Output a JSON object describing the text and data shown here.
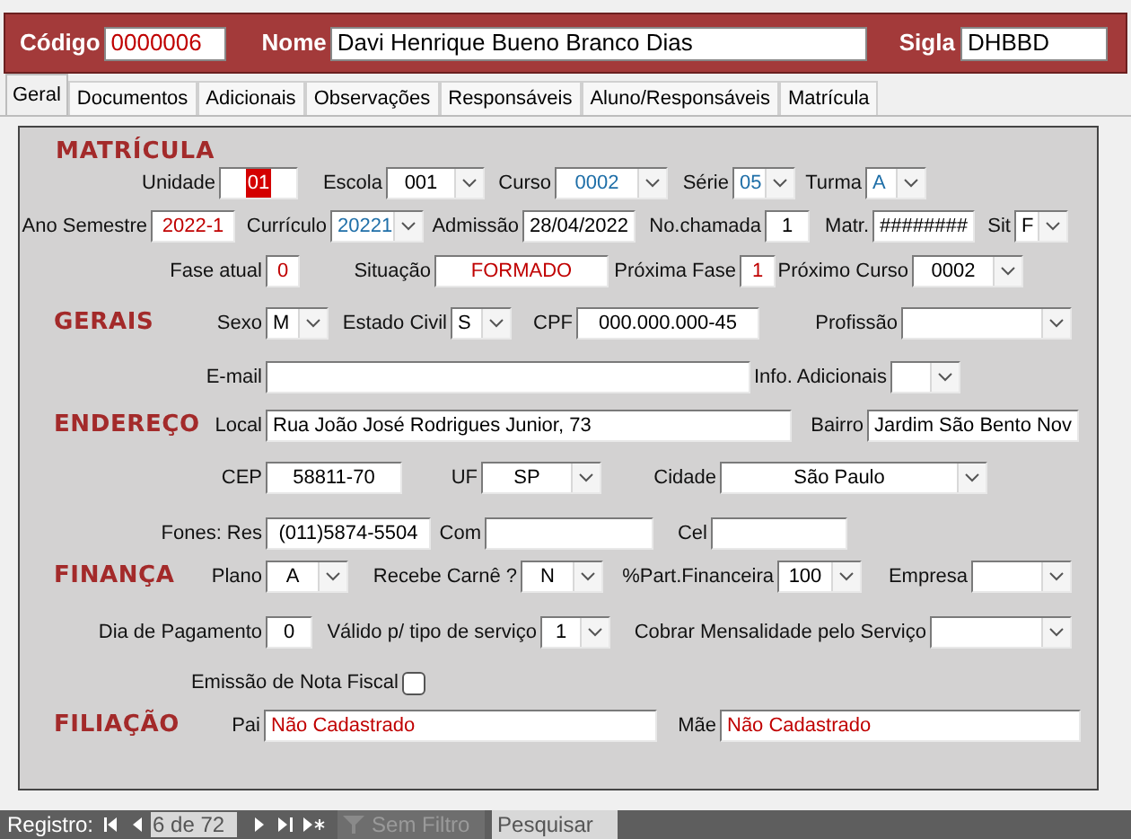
{
  "header": {
    "fields": [
      {
        "label": "Código",
        "value": "0000006",
        "color": "#c00000"
      },
      {
        "label": "Nome",
        "value": "Davi Henrique Bueno Branco Dias",
        "color": "#000000"
      },
      {
        "label": "Sigla",
        "value": "DHBBD",
        "color": "#000000"
      }
    ]
  },
  "tabs": [
    {
      "label": "Geral",
      "selected": true
    },
    {
      "label": "Documentos",
      "selected": false
    },
    {
      "label": "Adicionais",
      "selected": false
    },
    {
      "label": "Observações",
      "selected": false
    },
    {
      "label": "Responsáveis",
      "selected": false
    },
    {
      "label": "Aluno/Responsáveis",
      "selected": false
    },
    {
      "label": "Matrícula",
      "selected": false
    }
  ],
  "sections": [
    {
      "title": "MATRÍCULA",
      "title_inline": false,
      "rows": [
        {
          "fields": [
            {
              "kind": "highlight",
              "label": "Unidade",
              "value": "01",
              "color": "#d40000"
            },
            {
              "kind": "combo",
              "label": "Escola",
              "value": "001",
              "color": "#000000"
            },
            {
              "kind": "combo",
              "label": "Curso",
              "value": "0002",
              "color": "#1f6fa8"
            },
            {
              "kind": "combo",
              "label": "Série",
              "value": "05",
              "color": "#1f6fa8"
            },
            {
              "kind": "combo",
              "label": "Turma",
              "value": "A",
              "color": "#1f6fa8"
            }
          ]
        },
        {
          "fields": [
            {
              "kind": "text",
              "label": "Ano Semestre",
              "value": "2022-1",
              "color": "#c00000"
            },
            {
              "kind": "combo",
              "label": "Currículo",
              "value": "20221",
              "color": "#1f6fa8"
            },
            {
              "kind": "text",
              "label": "Admissão",
              "value": "28/04/2022",
              "color": "#000000"
            },
            {
              "kind": "text",
              "label": "No.chamada",
              "value": "1",
              "color": "#000000"
            },
            {
              "kind": "text",
              "label": "Matr.",
              "value": "########",
              "color": "#000000"
            },
            {
              "kind": "combo",
              "label": "Sit",
              "value": "F",
              "color": "#000000"
            }
          ]
        },
        {
          "fields": [
            {
              "kind": "text",
              "label": "Fase atual",
              "value": "0",
              "color": "#c00000"
            },
            {
              "kind": "text",
              "label": "Situação",
              "value": "FORMADO",
              "color": "#c00000"
            },
            {
              "kind": "text",
              "label": "Próxima Fase",
              "value": "1",
              "color": "#c00000"
            },
            {
              "kind": "combo",
              "label": "Próximo Curso",
              "value": "0002",
              "color": "#000000"
            }
          ]
        }
      ]
    },
    {
      "title": "GERAIS",
      "title_inline": true,
      "rows": [
        {
          "fields": [
            {
              "kind": "combo",
              "label": "Sexo",
              "value": "M",
              "color": "#000000"
            },
            {
              "kind": "combo",
              "label": "Estado Civil",
              "value": "S",
              "color": "#000000"
            },
            {
              "kind": "text",
              "label": "CPF",
              "value": "000.000.000-45",
              "color": "#000000"
            },
            {
              "kind": "combo",
              "label": "Profissão"
            }
          ]
        },
        {
          "fields": [
            {
              "kind": "text",
              "label": "E-mail"
            },
            {
              "kind": "combo",
              "label": "Info. Adicionais"
            }
          ]
        }
      ]
    },
    {
      "title": "ENDEREÇO",
      "title_inline": true,
      "rows": [
        {
          "fields": [
            {
              "kind": "text",
              "label": "Local",
              "value": "Rua João José Rodrigues Junior, 73",
              "color": "#000000"
            },
            {
              "kind": "text",
              "label": "Bairro",
              "value": "Jardim São Bento Nov",
              "color": "#000000"
            }
          ]
        },
        {
          "fields": [
            {
              "kind": "text",
              "label": "CEP",
              "value": "58811-70",
              "color": "#000000"
            },
            {
              "kind": "combo",
              "label": "UF",
              "value": "SP",
              "color": "#000000"
            },
            {
              "kind": "combo",
              "label": "Cidade",
              "value": "São Paulo",
              "color": "#000000"
            }
          ]
        },
        {
          "fields": [
            {
              "kind": "text",
              "label": "Fones: Res",
              "value": "(011)5874-5504",
              "color": "#000000"
            },
            {
              "kind": "text",
              "label": "Com"
            },
            {
              "kind": "text",
              "label": "Cel"
            }
          ]
        }
      ]
    },
    {
      "title": "FINANÇA",
      "title_inline": true,
      "rows": [
        {
          "fields": [
            {
              "kind": "combo",
              "label": "Plano",
              "value": "A",
              "color": "#000000"
            },
            {
              "kind": "combo",
              "label": "Recebe Carnê ?",
              "value": "N",
              "color": "#000000"
            },
            {
              "kind": "combo",
              "label": "%Part.Financeira",
              "value": "100",
              "color": "#000000"
            },
            {
              "kind": "combo",
              "label": "Empresa"
            }
          ]
        },
        {
          "fields": [
            {
              "kind": "text",
              "label": "Dia de Pagamento",
              "value": "0",
              "color": "#000000"
            },
            {
              "kind": "combo",
              "label": "Válido p/ tipo de serviço",
              "value": "1",
              "color": "#000000"
            },
            {
              "kind": "combo",
              "label": "Cobrar Mensalidade pelo Serviço"
            }
          ]
        },
        {
          "fields": [
            {
              "kind": "checkbox",
              "label": "Emissão de Nota Fiscal",
              "checked": false
            }
          ]
        }
      ]
    },
    {
      "title": "FILIAÇÃO",
      "title_inline": true,
      "rows": [
        {
          "fields": [
            {
              "kind": "text",
              "label": "Pai",
              "value": "Não Cadastrado",
              "color": "#c00000"
            },
            {
              "kind": "text",
              "label": "Mãe",
              "value": "Não Cadastrado",
              "color": "#c00000"
            }
          ]
        }
      ]
    }
  ],
  "status_bar": {
    "label": "Registro:",
    "position": "6 de 72",
    "filter": "Sem Filtro",
    "search_placeholder": "Pesquisar"
  }
}
